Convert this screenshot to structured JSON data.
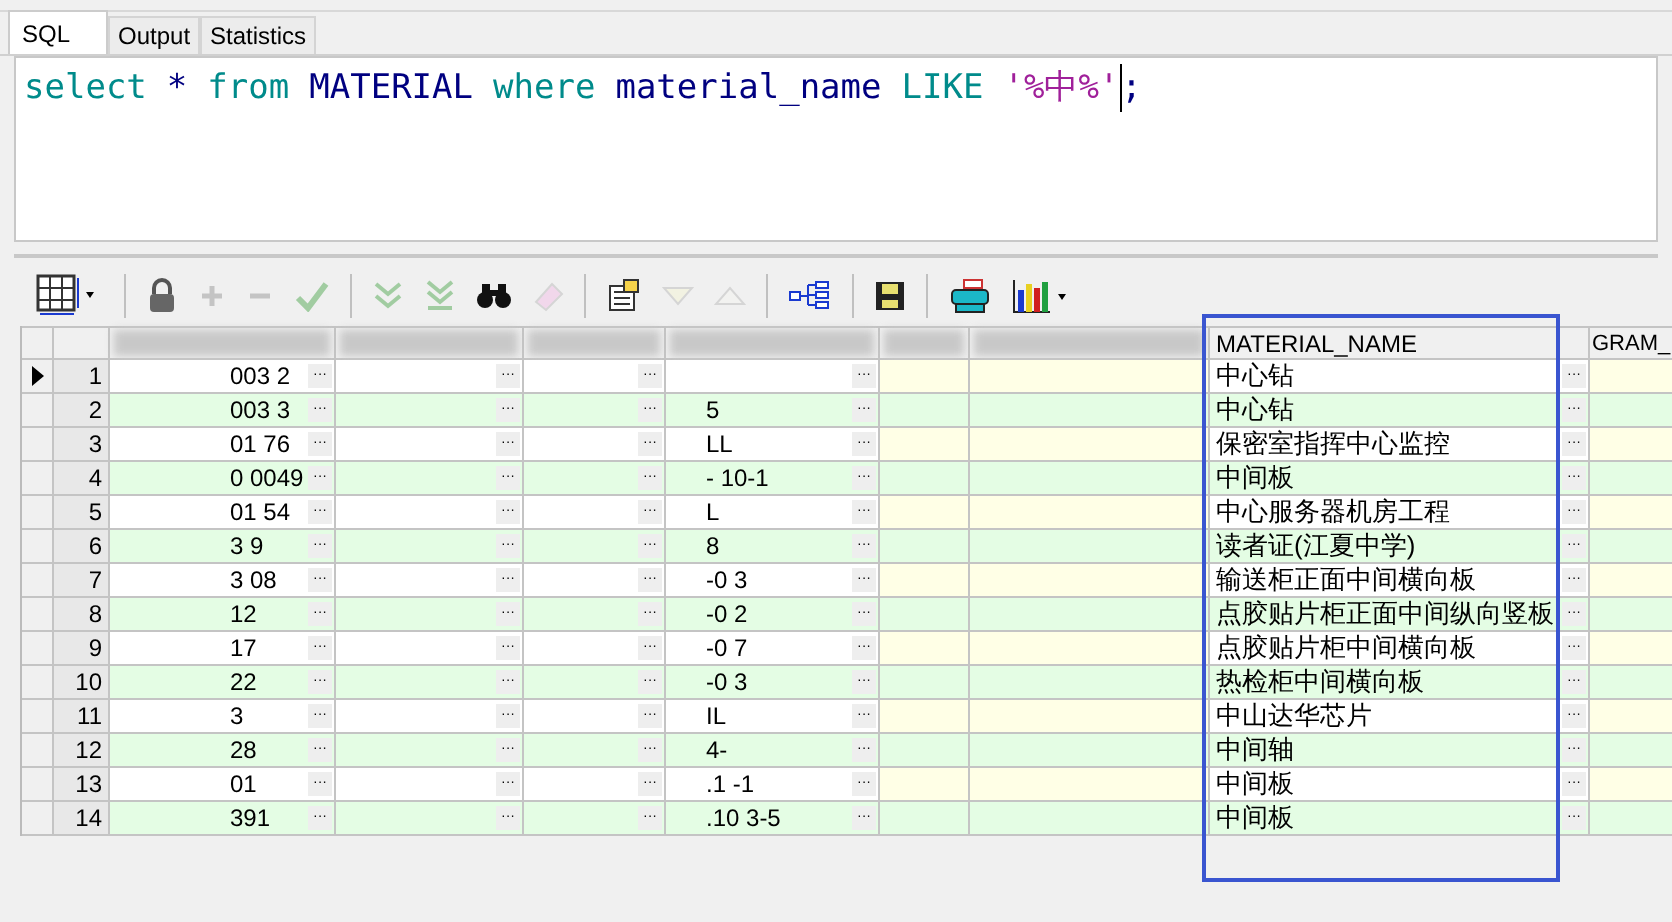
{
  "tabs": [
    {
      "label": "SQL",
      "selected": true
    },
    {
      "label": "Output",
      "selected": false
    },
    {
      "label": "Statistics",
      "selected": false
    }
  ],
  "query": [
    {
      "kind": "keyword",
      "text": "select"
    },
    {
      "kind": "operator",
      "text": "*"
    },
    {
      "kind": "keyword",
      "text": "from"
    },
    {
      "kind": "identifier",
      "text": "MATERIAL"
    },
    {
      "kind": "keyword",
      "text": "where"
    },
    {
      "kind": "identifier",
      "text": "material_name"
    },
    {
      "kind": "keyword",
      "text": "LIKE"
    },
    {
      "kind": "string",
      "text": "'%中%'"
    },
    {
      "kind": "punct",
      "text": ";"
    }
  ],
  "toolbar": [
    {
      "kind": "grid",
      "disabled": false
    },
    {
      "kind": "lock",
      "disabled": false
    },
    {
      "kind": "plus",
      "disabled": true
    },
    {
      "kind": "minus",
      "disabled": true
    },
    {
      "kind": "check",
      "disabled": true
    },
    {
      "kind": "chevrons",
      "disabled": true
    },
    {
      "kind": "chevrons-bar",
      "disabled": true
    },
    {
      "kind": "binoculars",
      "disabled": false
    },
    {
      "kind": "eraser",
      "disabled": true
    },
    {
      "kind": "clipboard",
      "disabled": false
    },
    {
      "kind": "triangle-down",
      "disabled": true
    },
    {
      "kind": "triangle-up",
      "disabled": true
    },
    {
      "kind": "tree",
      "disabled": false
    },
    {
      "kind": "floppy",
      "disabled": false
    },
    {
      "kind": "printer",
      "disabled": false
    },
    {
      "kind": "chart",
      "disabled": false
    }
  ],
  "table": {
    "columns": [
      {
        "label": "MATERIAL_NAME"
      },
      {
        "label": "GRAM_"
      }
    ],
    "rows": [
      {
        "number": "1",
        "current": true,
        "column_1": "003 2",
        "column_4": "",
        "material_name": "中心钻"
      },
      {
        "number": "2",
        "current": false,
        "column_1": "003 3",
        "column_4": "5",
        "material_name": "中心钻"
      },
      {
        "number": "3",
        "current": false,
        "column_1": "01 76",
        "column_4": "LL",
        "material_name": "保密室指挥中心监控"
      },
      {
        "number": "4",
        "current": false,
        "column_1": "0 0049",
        "column_4": "- 10-1",
        "material_name": "中间板"
      },
      {
        "number": "5",
        "current": false,
        "column_1": "01 54",
        "column_4": "L",
        "material_name": "中心服务器机房工程"
      },
      {
        "number": "6",
        "current": false,
        "column_1": "3 9",
        "column_4": "8",
        "material_name": "读者证(江夏中学)"
      },
      {
        "number": "7",
        "current": false,
        "column_1": "3 08",
        "column_4": "-0 3",
        "material_name": "输送柜正面中间横向板"
      },
      {
        "number": "8",
        "current": false,
        "column_1": "12",
        "column_4": "-0 2",
        "material_name": "点胶贴片柜正面中间纵向竖板"
      },
      {
        "number": "9",
        "current": false,
        "column_1": "17",
        "column_4": "-0 7",
        "material_name": "点胶贴片柜中间横向板"
      },
      {
        "number": "10",
        "current": false,
        "column_1": "22",
        "column_4": "-0 3",
        "material_name": "热检柜中间横向板"
      },
      {
        "number": "11",
        "current": false,
        "column_1": "3",
        "column_4": "IL",
        "material_name": "中山达华芯片"
      },
      {
        "number": "12",
        "current": false,
        "column_1": "28",
        "column_4": "4-",
        "material_name": "中间轴"
      },
      {
        "number": "13",
        "current": false,
        "column_1": "01",
        "column_4": ".1 -1",
        "material_name": "中间板"
      },
      {
        "number": "14",
        "current": false,
        "column_1": "391",
        "column_4": ".10 3-5",
        "material_name": "中间板"
      }
    ],
    "ellipsis": "···"
  }
}
